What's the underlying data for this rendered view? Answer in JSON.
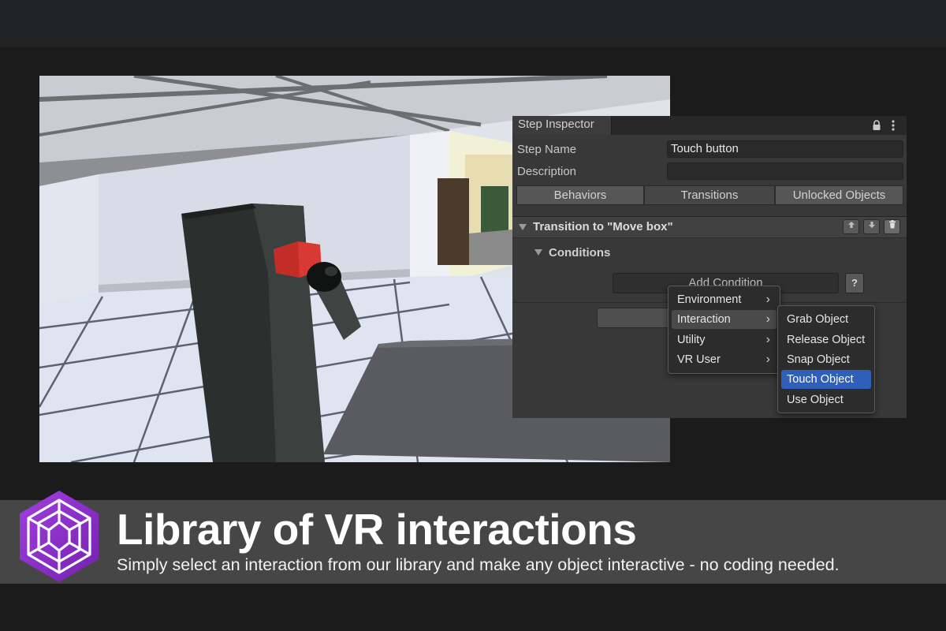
{
  "inspector": {
    "tab_title": "Step Inspector",
    "step_name_label": "Step Name",
    "step_name_value": "Touch button",
    "description_label": "Description",
    "description_value": "",
    "tabs": [
      "Behaviors",
      "Transitions",
      "Unlocked Objects"
    ],
    "active_tab": "Transitions",
    "transition_title": "Transition to \"Move box\"",
    "conditions_label": "Conditions",
    "add_condition_label": "Add Condition",
    "help_label": "?"
  },
  "condition_menu": {
    "items": [
      "Environment",
      "Interaction",
      "Utility",
      "VR User"
    ],
    "highlighted": "Interaction"
  },
  "interaction_submenu": {
    "items": [
      "Grab Object",
      "Release Object",
      "Snap Object",
      "Touch Object",
      "Use Object"
    ],
    "selected": "Touch Object"
  },
  "banner": {
    "title": "Library of VR interactions",
    "subtitle": "Simply select an interaction from our library and make any object interactive - no coding needed."
  },
  "colors": {
    "accent_purple": "#8a2fc9",
    "selection_blue": "#2f5fb8",
    "banner_bg": "#464646"
  }
}
